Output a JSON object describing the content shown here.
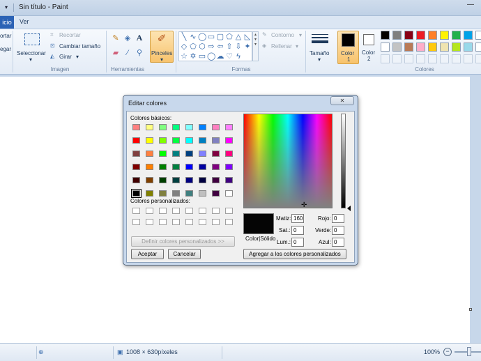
{
  "window": {
    "title": "Sin título - Paint",
    "qat_icon": "chevron-down-icon",
    "minimize_glyph": "—"
  },
  "tabs": {
    "file": "icio",
    "view": "Ver"
  },
  "ribbon": {
    "clipboard": {
      "cut": "ortar",
      "paste": "egar"
    },
    "image": {
      "select_label": "Seleccionar",
      "crop": "Recortar",
      "resize": "Cambiar tamaño",
      "rotate": "Girar",
      "group_label": "Imagen"
    },
    "tools": {
      "group_label": "Herramientas",
      "brushes": "Pinceles"
    },
    "shapes": {
      "outline": "Contorno",
      "fill": "Rellenar",
      "group_label": "Formas"
    },
    "size_label": "Tamaño",
    "color1": {
      "line1": "Color",
      "line2": "1"
    },
    "color2": {
      "line1": "Color",
      "line2": "2"
    },
    "colors_group_label": "Colores",
    "palette_row1": [
      "#000000",
      "#7f7f7f",
      "#880015",
      "#ed1c24",
      "#ff7f27",
      "#fff200",
      "#22b14c",
      "#00a2e8"
    ],
    "palette_row2": [
      "#ffffff",
      "#c3c3c3",
      "#b97a57",
      "#ffaec9",
      "#ffc90e",
      "#efe4b0",
      "#b5e61d",
      "#99d9ea"
    ]
  },
  "statusbar": {
    "dimensions": "1008 × 630píxeles",
    "zoom": "100%"
  },
  "dialog": {
    "title": "Editar colores",
    "close_glyph": "✕",
    "basic_colors_label": "Colores básicos:",
    "custom_colors_label": "Colores personalizados:",
    "define_custom_button": "Definir colores personalizados >>",
    "ok_button": "Aceptar",
    "cancel_button": "Cancelar",
    "add_custom_button": "Agregar a los colores personalizados",
    "color_solid_label": "Color|Sólido",
    "fields": {
      "hue_label": "Matiz:",
      "hue": "160",
      "sat_label": "Sat.:",
      "sat": "0",
      "lum_label": "Lum.:",
      "lum": "0",
      "red_label": "Rojo:",
      "red": "0",
      "green_label": "Verde:",
      "green": "0",
      "blue_label": "Azul:",
      "blue": "0"
    },
    "basic_colors": [
      [
        "#ff8080",
        "#ffff80",
        "#80ff80",
        "#00ff80",
        "#80ffff",
        "#0080ff",
        "#ff80c0",
        "#ff80ff"
      ],
      [
        "#ff0000",
        "#ffff00",
        "#80ff00",
        "#00ff40",
        "#00ffff",
        "#0080c0",
        "#8080c0",
        "#ff00ff"
      ],
      [
        "#804040",
        "#ff8040",
        "#00ff00",
        "#008080",
        "#004080",
        "#8080ff",
        "#800040",
        "#ff0080"
      ],
      [
        "#800000",
        "#ff8000",
        "#008000",
        "#008040",
        "#0000ff",
        "#0000a0",
        "#800080",
        "#8000ff"
      ],
      [
        "#400000",
        "#804000",
        "#004000",
        "#004040",
        "#000080",
        "#000040",
        "#400040",
        "#400080"
      ],
      [
        "#000000",
        "#808000",
        "#808040",
        "#808080",
        "#408080",
        "#c0c0c0",
        "#400040",
        "#ffffff"
      ]
    ],
    "selected_basic": "#000000"
  }
}
